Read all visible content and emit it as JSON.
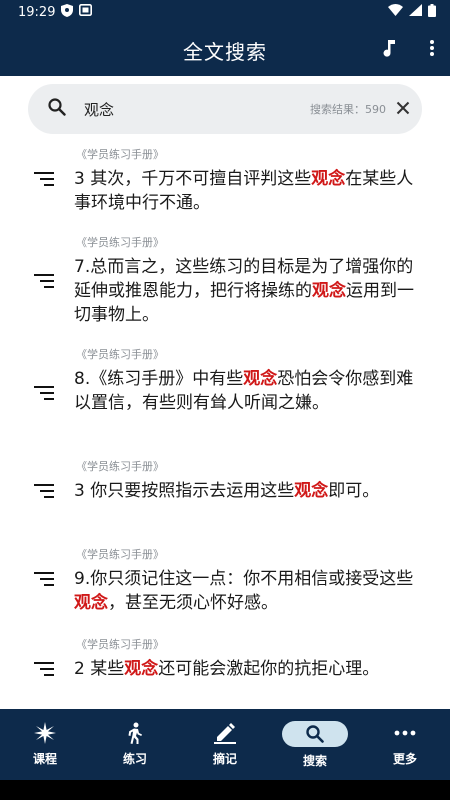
{
  "status": {
    "time": "19:29"
  },
  "app": {
    "title": "全文搜索"
  },
  "search": {
    "query": "观念",
    "result_label": "搜索结果：",
    "result_count": "590"
  },
  "colors": {
    "primary": "#0d2a4b",
    "highlight": "#d01818"
  },
  "items": [
    {
      "source": "《学员练习手册》",
      "segments": [
        "3 其次，千万不可擅自评判这些",
        "观念",
        "在某些人事环境中行不通。"
      ]
    },
    {
      "source": "《学员练习手册》",
      "segments": [
        "7.总而言之，这些练习的目标是为了增强你的延伸或推恩能力，把行将操练的",
        "观念",
        "运用到一切事物上。"
      ]
    },
    {
      "source": "《学员练习手册》",
      "segments": [
        "8.《练习手册》中有些",
        "观念",
        "恐怕会令你感到难以置信，有些则有耸人听闻之嫌。"
      ]
    },
    {
      "source": "《学员练习手册》",
      "segments": [
        "3 你只要按照指示去运用这些",
        "观念",
        "即可。"
      ]
    },
    {
      "source": "《学员练习手册》",
      "segments": [
        "9.你只须记住这一点：你不用相信或接受这些",
        "观念",
        "，甚至无须心怀好感。"
      ]
    },
    {
      "source": "《学员练习手册》",
      "segments": [
        "2 某些",
        "观念",
        "还可能会激起你的抗拒心理。"
      ]
    }
  ],
  "nav": [
    {
      "label": "课程",
      "icon": "spark-icon"
    },
    {
      "label": "练习",
      "icon": "walk-icon"
    },
    {
      "label": "摘记",
      "icon": "pen-icon"
    },
    {
      "label": "搜索",
      "icon": "search-icon"
    },
    {
      "label": "更多",
      "icon": "more-icon"
    }
  ]
}
